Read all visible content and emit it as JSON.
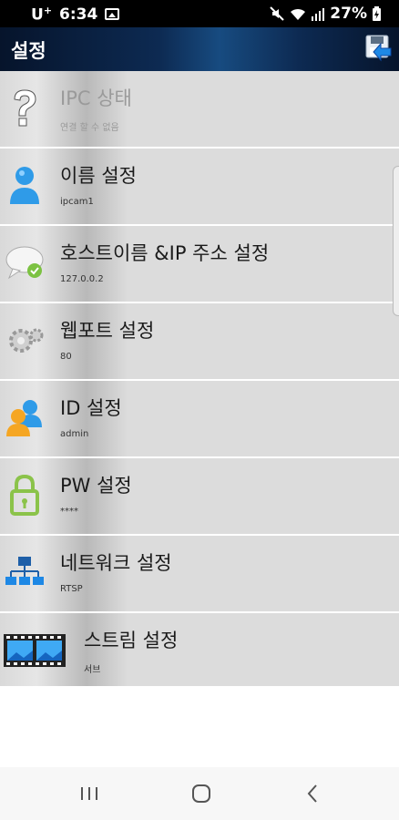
{
  "status_bar": {
    "carrier": "U",
    "carrier_sup": "+",
    "time": "6:34",
    "battery": "27%"
  },
  "header": {
    "title": "설정"
  },
  "items": [
    {
      "title": "IPC 상태",
      "subtitle": "연결 할 수 없음",
      "icon": "question-icon",
      "disabled": true
    },
    {
      "title": "이름 설정",
      "subtitle": "ipcam1",
      "icon": "user-icon"
    },
    {
      "title": "호스트이름 &IP 주소 설정",
      "subtitle": "127.0.0.2",
      "icon": "chat-bubble-check-icon"
    },
    {
      "title": "웹포트 설정",
      "subtitle": "80",
      "icon": "gear-icon"
    },
    {
      "title": "ID 설정",
      "subtitle": "admin",
      "icon": "users-icon"
    },
    {
      "title": "PW 설정",
      "subtitle": "****",
      "icon": "lock-icon"
    },
    {
      "title": "네트워크 설정",
      "subtitle": "RTSP",
      "icon": "network-icon"
    },
    {
      "title": "스트림 설정",
      "subtitle": "서브",
      "icon": "film-icon"
    }
  ],
  "colors": {
    "header_bg": "#0d2a52",
    "row_bg": "#dcdcdc",
    "accent_green": "#7cc242",
    "accent_blue": "#1e88e5"
  }
}
